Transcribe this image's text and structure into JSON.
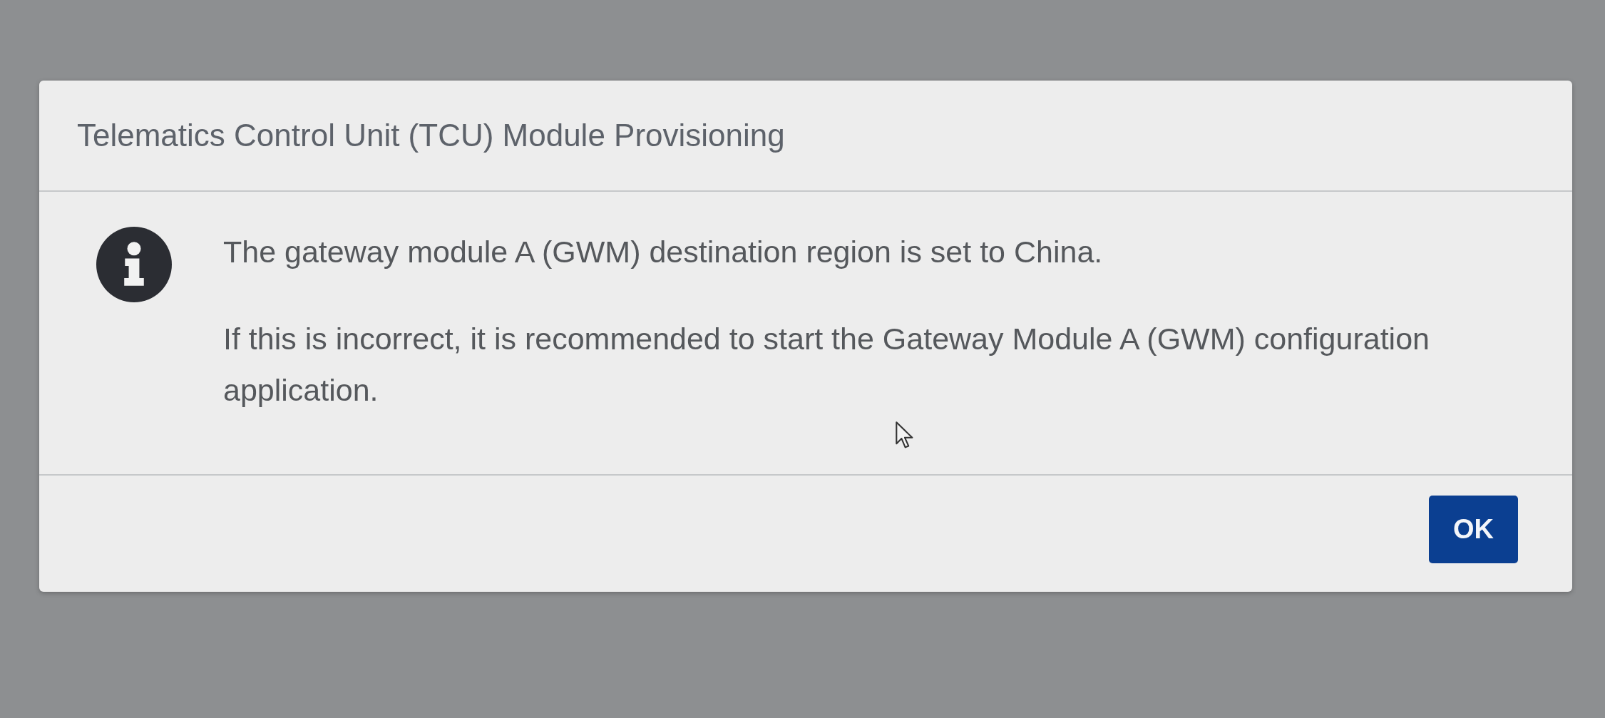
{
  "dialog": {
    "title": "Telematics Control Unit (TCU) Module Provisioning",
    "message": [
      "The gateway module A (GWM) destination region is set to China.",
      "If this is incorrect, it is recommended to start the Gateway Module A (GWM) configuration application."
    ],
    "buttons": [
      {
        "label": "OK",
        "kind": "primary"
      }
    ]
  }
}
